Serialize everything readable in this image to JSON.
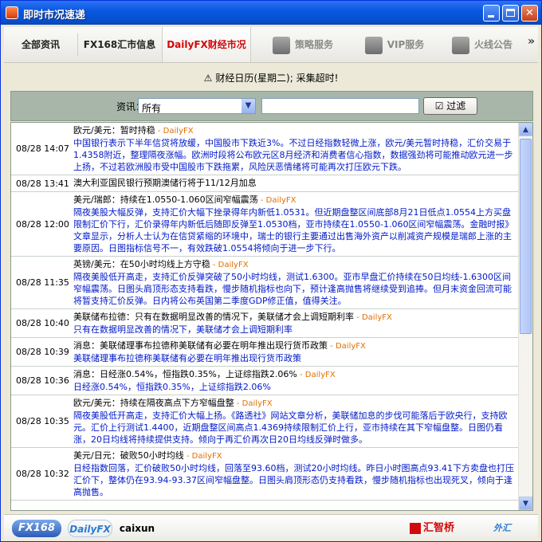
{
  "window": {
    "title": "即时市况速递",
    "minimize_label": "_",
    "maximize_label": "□",
    "close_label": "✕"
  },
  "tabs": [
    {
      "label": "全部资讯",
      "active": false,
      "dim": false
    },
    {
      "label": "FX168汇市信息",
      "active": false,
      "dim": false
    },
    {
      "label": "DailyFX财经市况",
      "active": true,
      "dim": false
    },
    {
      "label": "策略服务",
      "active": false,
      "dim": true
    },
    {
      "label": "VIP服务",
      "active": false,
      "dim": true
    },
    {
      "label": "火线公告",
      "active": false,
      "dim": true
    }
  ],
  "tab_next_label": "»",
  "notice": "财经日历(星期二); 采集超时!",
  "filter": {
    "label": "资讯：",
    "select_value": "所有",
    "search_value": "",
    "button_label": "过滤"
  },
  "news": [
    {
      "time": "08/28 14:07",
      "headline": "欧元/美元：暂时持稳",
      "source": " - DailyFX",
      "body": "中国银行表示下半年信贷将放缓，中国股市下跌近3%。不过日经指数轻微上涨，欧元/美元暂时持稳，汇价交易于1.4358附近，整理隔夜涨幅。欧洲时段将公布欧元区8月经济和消费者信心指数，数据强劲将可能推动欧元进一步上扬，不过若欧洲股市受中国股市下跌拖累，风险厌恶情绪将可能再次打压欧元下跌。"
    },
    {
      "time": "08/28 13:41",
      "headline": "澳大利亚国民银行预期澳储行将于11/12月加息",
      "source": "",
      "body": ""
    },
    {
      "time": "08/28 12:00",
      "headline": "美元/瑞郎：持续在1.0550-1.060区间窄幅震荡",
      "source": " - DailyFX",
      "body": "隔夜美股大幅反弹，支持汇价大幅下挫录得年内新低1.0531。但近期盘整区间底部8月21日低点1.0554上方买盘限制汇价下行，汇价录得年内新低后随即反弹至1.0530档，亚市持续在1.0550-1.060区间窄幅震荡。金融时报》文章显示，分析人士认为在信贷紧缩的环境中，瑞士的银行主要通过出售海外资产以削减资产规模是瑞郎上涨的主要原因。日图指标信号不一，有效跌破1.0554将倾向于进一步下行。"
    },
    {
      "time": "08/28 11:35",
      "headline": "英镑/美元：在50小时均线上方守稳",
      "source": " - DailyFX",
      "body": "隔夜美股低开高走，支持汇价反弹突破了50小时均线，测试1.6300。亚市早盘汇价持续在50日均线-1.6300区间窄幅震荡。日图头肩顶形态支持看跌，慢步随机指标也向下，预计逢高抛售将继续受到追捧。但月末资金回流可能将暂支持汇价反弹。日内将公布英国第二季度GDP修正值，值得关注。"
    },
    {
      "time": "08/28 10:40",
      "headline": "美联储布拉德：只有在数据明显改善的情况下，美联储才会上调短期利率",
      "source": " - DailyFX",
      "body": "只有在数据明显改善的情况下，美联储才会上调短期利率"
    },
    {
      "time": "08/28 10:39",
      "headline": "消息：美联储理事布拉德称美联储有必要在明年推出现行货币政策",
      "source": " - DailyFX",
      "body": "美联储理事布拉德称美联储有必要在明年推出现行货币政策"
    },
    {
      "time": "08/28 10:36",
      "headline": "消息：日经涨0.54%，恒指跌0.35%，上证综指跌2.06%",
      "source": " - DailyFX",
      "body": "日经涨0.54%，恒指跌0.35%，上证综指跌2.06%"
    },
    {
      "time": "08/28 10:35",
      "headline": "欧元/美元：持续在隔夜高点下方窄幅盘整",
      "source": " - DailyFX",
      "body": "隔夜美股低开高走，支持汇价大幅上扬。《路透社》网站文章分析，美联储加息的步伐可能落后于欧央行，支持欧元。汇价上行测试1.4400，近期盘整区间高点1.4369持续限制汇价上行，亚市持续在其下窄幅盘整。日图仍看涨，20日均线将持续提供支持。倾向于再汇价再次日20日均线反弹时做多。"
    },
    {
      "time": "08/28 10:32",
      "headline": "美元/日元：破败50小时均线",
      "source": " - DailyFX",
      "body": "日经指数回落，汇价破败50小时均线，回落至93.60档，测试20小时均线。昨日小时图高点93.41下方卖盘也打压汇价下，整体仍在93.94-93.37区间窄幅盘整。日图头肩顶形态仍支持看跌，慢步随机指标也出现死叉，倾向于逢高抛售。"
    }
  ],
  "footer_logos": [
    "FX168",
    "DailyFX",
    "caixun",
    "汇智桥",
    "外汇"
  ]
}
